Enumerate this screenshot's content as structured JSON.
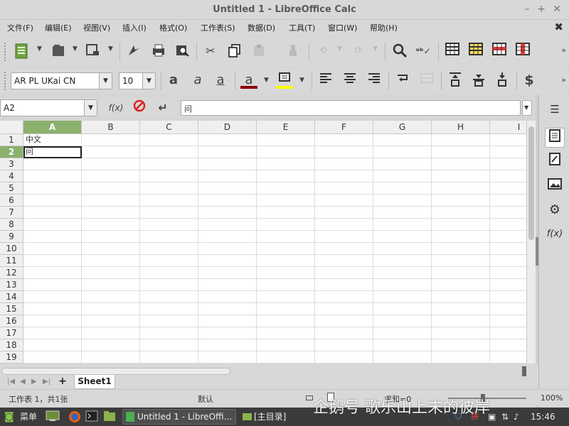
{
  "window": {
    "title": "Untitled 1 - LibreOffice Calc",
    "min_symbol": "–",
    "max_symbol": "+",
    "close_symbol": "✕"
  },
  "menubar": {
    "items": [
      "文件(F)",
      "编辑(E)",
      "视图(V)",
      "插入(I)",
      "格式(O)",
      "工作表(S)",
      "数据(D)",
      "工具(T)",
      "窗口(W)",
      "帮助(H)"
    ],
    "close_doc": "✖"
  },
  "format_toolbar": {
    "font_name": "AR PL UKai CN",
    "font_size": "10",
    "currency_symbol": "$",
    "font_color": "#8b0000",
    "highlight_color": "#ffff00"
  },
  "formula_bar": {
    "name_box": "A2",
    "function_label": "f(x)",
    "content": "问"
  },
  "columns": [
    "A",
    "B",
    "C",
    "D",
    "E",
    "F",
    "G",
    "H",
    "I"
  ],
  "rows": [
    "1",
    "2",
    "3",
    "4",
    "5",
    "6",
    "7",
    "8",
    "9",
    "10",
    "11",
    "12",
    "13",
    "14",
    "15",
    "16",
    "17",
    "18",
    "19"
  ],
  "cells": {
    "A1": "中文",
    "A2": "问"
  },
  "active_cell": {
    "column": "A",
    "row": "2"
  },
  "accent_color": "#8cb06e",
  "sidebar": {
    "fx_label": "f(x)"
  },
  "sheet_tabs": {
    "add_symbol": "+",
    "tabs": [
      "Sheet1"
    ]
  },
  "statusbar": {
    "sheet_info": "工作表 1，共1张",
    "page_style": "默认",
    "sum_label": "求和=0",
    "zoom": "100%"
  },
  "taskbar": {
    "menu_label": "菜单",
    "task_calc": "Untitled 1 - LibreOffi...",
    "task_folder": "[主目录]",
    "clock": "15:46"
  },
  "watermark": "企鹅号 歌乐山上末的彼岸"
}
